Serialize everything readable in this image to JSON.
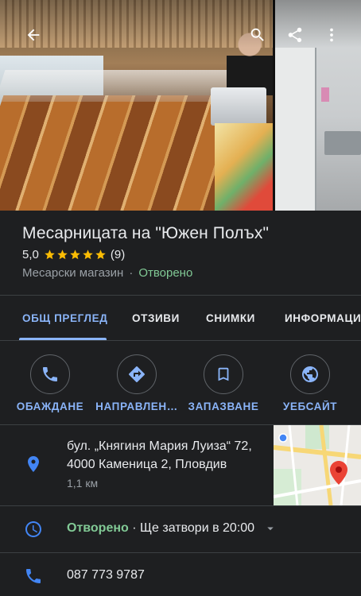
{
  "header": {
    "back_icon": "arrow-back-icon",
    "search_icon": "search-icon",
    "share_icon": "share-icon",
    "more_icon": "more-vert-icon"
  },
  "place": {
    "name": "Месарницата на \"Южен Полъх\"",
    "rating": "5,0",
    "stars": 5,
    "review_count": "(9)",
    "category": "Месарски магазин",
    "separator": "·",
    "status": "Отворено"
  },
  "tabs": [
    {
      "label": "ОБЩ ПРЕГЛЕД",
      "active": true
    },
    {
      "label": "ОТЗИВИ",
      "active": false
    },
    {
      "label": "СНИМКИ",
      "active": false
    },
    {
      "label": "ИНФОРМАЦИ",
      "active": false
    }
  ],
  "actions": [
    {
      "label": "ОБАЖДАНЕ",
      "icon": "phone-icon"
    },
    {
      "label": "НАПРАВЛЕН…",
      "icon": "directions-icon"
    },
    {
      "label": "ЗАПАЗВАНЕ",
      "icon": "bookmark-icon"
    },
    {
      "label": "УЕБСАЙТ",
      "icon": "globe-icon"
    }
  ],
  "address": {
    "line1": "бул. „Княгиня Мария Луиза“ 72,",
    "line2": "4000 Каменица 2, Пловдив",
    "distance": "1,1 км",
    "icon": "location-pin-icon"
  },
  "hours": {
    "status": "Отворено",
    "separator": " · ",
    "closes": "Ще затвори в 20:00",
    "icon": "clock-icon"
  },
  "phone": {
    "number": "087 773 9787",
    "icon": "phone-icon"
  },
  "colors": {
    "background": "#1e1f21",
    "accent": "#8ab4f8",
    "open_green": "#81c995",
    "star": "#fbbc04",
    "icon_blue": "#4285f4",
    "divider": "#3c4043"
  }
}
